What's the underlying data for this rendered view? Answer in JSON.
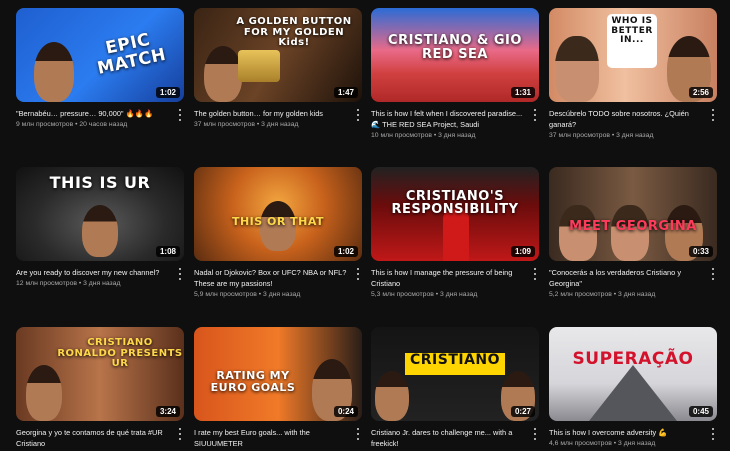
{
  "videos": [
    {
      "title": "\"Bernabéu… pressure… 90,000\" 🔥🔥🔥",
      "views": "9 млн просмотров",
      "age": "20 часов назад",
      "duration": "1:02",
      "overlay": "EPIC MATCH"
    },
    {
      "title": "The golden button… for my golden kids",
      "views": "37 млн просмотров",
      "age": "3 дня назад",
      "duration": "1:47",
      "overlay": "A GOLDEN BUTTON FOR MY GOLDEN Kids!"
    },
    {
      "title": "This is how I felt when I discovered paradise... 🌊 THE RED SEA Project, Saudi",
      "views": "10 млн просмотров",
      "age": "3 дня назад",
      "duration": "1:31",
      "overlay": "CRISTIANO & GIO RED SEA"
    },
    {
      "title": "Descúbrelo TODO sobre nosotros. ¿Quién ganará?",
      "views": "37 млн просмотров",
      "age": "3 дня назад",
      "duration": "2:56",
      "overlay": "WHO IS BETTER IN..."
    },
    {
      "title": "Are you ready to discover my new channel?",
      "views": "12 млн просмотров",
      "age": "3 дня назад",
      "duration": "1:08",
      "overlay": "THIS IS UR"
    },
    {
      "title": "Nadal or Djokovic? Box or UFC? NBA or NFL? These are my passions!",
      "views": "5,9 млн просмотров",
      "age": "3 дня назад",
      "duration": "1:02",
      "overlay": "THIS OR THAT"
    },
    {
      "title": "This is how I manage the pressure of being Cristiano",
      "views": "5,3 млн просмотров",
      "age": "3 дня назад",
      "duration": "1:09",
      "overlay": "CRISTIANO'S RESPONSIBILITY"
    },
    {
      "title": "\"Conocerás a los verdaderos Cristiano y Georgina\"",
      "views": "5,2 млн просмотров",
      "age": "3 дня назад",
      "duration": "0:33",
      "overlay": "MEET GEORGINA"
    },
    {
      "title": "Georgina y yo te contamos de qué trata #UR Cristiano",
      "views": "",
      "age": "",
      "duration": "3:24",
      "overlay": "CRISTIANO RONALDO PRESENTS UR"
    },
    {
      "title": "I rate my best Euro goals... with the SIUUUMETER",
      "views": "",
      "age": "",
      "duration": "0:24",
      "overlay": "RATING MY EURO GOALS"
    },
    {
      "title": "Cristiano Jr. dares to challenge me... with a freekick!",
      "views": "",
      "age": "",
      "duration": "0:27",
      "overlay": "CRISTIANO"
    },
    {
      "title": "This is how I overcome adversity 💪",
      "views": "4,6 млн просмотров",
      "age": "3 дня назад",
      "duration": "0:45",
      "overlay": "SUPERAÇÃO"
    }
  ],
  "separator": "•",
  "colors": {
    "bg": "#0f0f0f",
    "text": "#f1f1f1",
    "meta": "#aaaaaa"
  }
}
